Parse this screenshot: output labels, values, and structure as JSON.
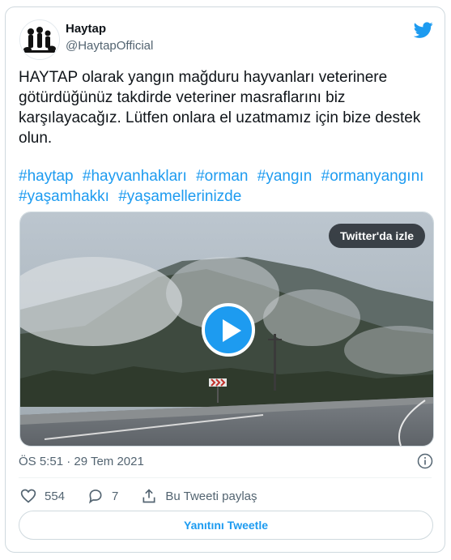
{
  "author": {
    "name": "Haytap",
    "handle": "@HaytapOfficial"
  },
  "tweet": {
    "text": "HAYTAP olarak yangın mağduru hayvanları veterinere götürdüğünüz takdirde veteriner masraflarını biz karşılayacağız. Lütfen onlara el uzatmamız için bize destek olun.",
    "hashtags": [
      "#haytap",
      "#hayvanhakları",
      "#orman",
      "#yangın",
      "#ormanyangını",
      "#yaşamhakkı",
      "#yaşamellerinizde"
    ]
  },
  "media": {
    "watch_label": "Twitter'da izle",
    "play_icon": "play-icon"
  },
  "meta": {
    "timestamp": "ÖS 5:51 · 29 Tem 2021"
  },
  "actions": {
    "likes": "554",
    "replies": "7",
    "share_label": "Bu Tweeti paylaş"
  },
  "reply_button": "Yanıtını Tweetle",
  "colors": {
    "accent": "#1d9bf0",
    "text": "#0f1419",
    "muted": "#536471",
    "border": "#cfd9de"
  }
}
